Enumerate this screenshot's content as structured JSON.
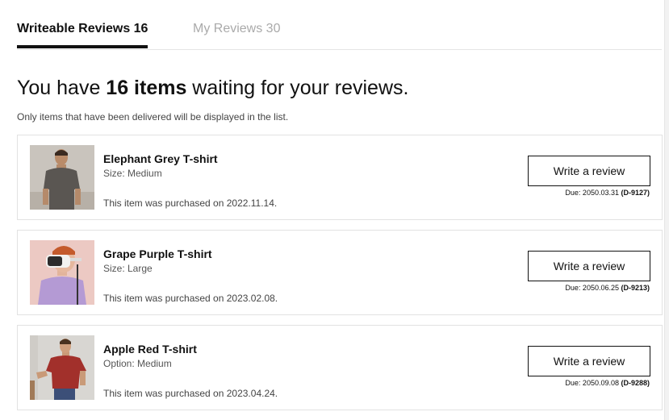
{
  "tabs": [
    {
      "label": "Writeable Reviews 16"
    },
    {
      "label": "My Reviews 30"
    }
  ],
  "headline": {
    "prefix": "You have ",
    "count": "16 items",
    "suffix": " waiting for your reviews."
  },
  "notice": "Only items that have been delivered will be displayed in the list.",
  "items": [
    {
      "name": "Elephant Grey T-shirt",
      "option": "Size: Medium",
      "purchase": "This item was purchased on 2022.11.14.",
      "button": "Write a review",
      "due": "Due: 2050.03.31 ",
      "dday": "(D-9127)",
      "image": "man-grey-tshirt"
    },
    {
      "name": "Grape Purple T-shirt",
      "option": "Size: Large",
      "purchase": "This item was purchased on 2023.02.08.",
      "button": "Write a review",
      "due": "Due: 2050.06.25 ",
      "dday": "(D-9213)",
      "image": "boy-vr-headset-purple-tshirt"
    },
    {
      "name": "Apple Red T-shirt",
      "option": "Option: Medium",
      "purchase": "This item was purchased on 2023.04.24.",
      "button": "Write a review",
      "due": "Due: 2050.09.08 ",
      "dday": "(D-9288)",
      "image": "man-red-tshirt"
    }
  ]
}
